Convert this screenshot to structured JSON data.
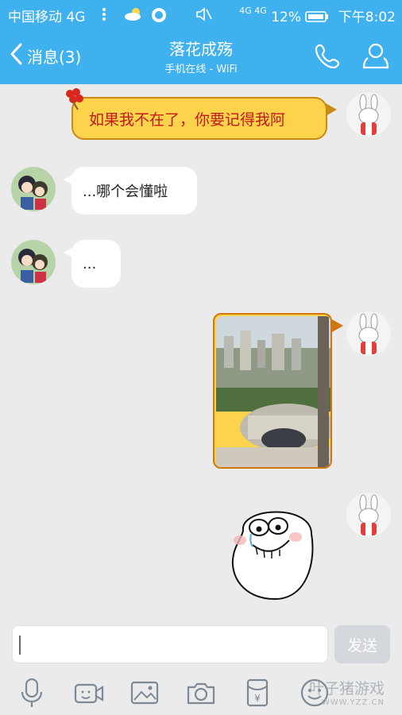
{
  "status_bar": {
    "carrier": "中国移动 4G",
    "signal": "4G 4G",
    "battery": "12%",
    "time": "下午8:02"
  },
  "header": {
    "back_label": "消息(3)",
    "contact_name": "落花成殇",
    "contact_status": "手机在线 - WiFi",
    "icons": [
      "back-chevron-icon",
      "phone-icon",
      "profile-icon"
    ]
  },
  "messages": [
    {
      "side": "right",
      "type": "special-text",
      "text": "如果我不在了，你要记得我阿"
    },
    {
      "side": "left",
      "type": "text",
      "text": "...哪个会懂啦"
    },
    {
      "side": "left",
      "type": "text",
      "text": "..."
    },
    {
      "side": "right",
      "type": "image",
      "description_icon": "city-photo"
    },
    {
      "side": "right",
      "type": "sticker",
      "description_icon": "forever-alone-face"
    }
  ],
  "input": {
    "value": "",
    "placeholder": "",
    "send_label": "发送"
  },
  "toolbar": {
    "items": [
      "microphone-icon",
      "video-call-icon",
      "image-icon",
      "camera-icon",
      "red-packet-icon",
      "emoji-icon"
    ],
    "red_packet_symbol": "¥"
  },
  "watermark": {
    "line1": "叶子猪游戏",
    "line2": "WWW.YZZ.CN"
  },
  "colors": {
    "header_bg": "#3fb1ee",
    "special_bubble_bg": "#fcd34a",
    "special_bubble_text": "#c11a1a",
    "chat_bg": "#ebebeb"
  }
}
